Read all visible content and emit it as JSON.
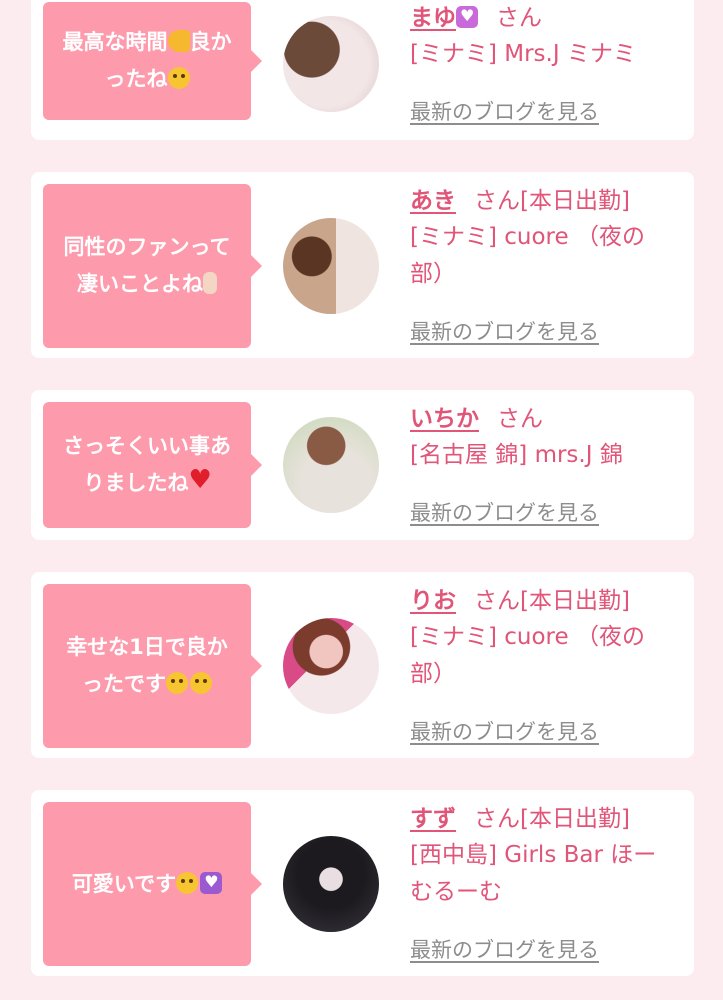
{
  "entries": [
    {
      "comment_lines": [
        "最高な時間",
        "ったね"
      ],
      "name": "まゆ",
      "san": "さん",
      "badge": "",
      "shop_lines": [
        "[ミナミ] Mrs.J ミナミ"
      ],
      "blog_link": "最新のブログを見る"
    },
    {
      "comment_lines": [
        "同性のファンって",
        "凄いことよね"
      ],
      "name": "あき",
      "san": "さん",
      "badge": "[本日出勤]",
      "shop_lines": [
        "[ミナミ] cuore （夜の",
        "部）"
      ],
      "blog_link": "最新のブログを見る"
    },
    {
      "comment_lines": [
        "さっそくいい事あ",
        "りましたね"
      ],
      "name": "いちか",
      "san": "さん",
      "badge": "",
      "shop_lines": [
        "[名古屋 錦] mrs.J 錦"
      ],
      "blog_link": "最新のブログを見る"
    },
    {
      "comment_lines": [
        "幸せな1日で良か",
        "ったです"
      ],
      "name": "りお",
      "san": "さん",
      "badge": "[本日出勤]",
      "shop_lines": [
        "[ミナミ] cuore （夜の",
        "部）"
      ],
      "blog_link": "最新のブログを見る"
    },
    {
      "comment_lines": [
        "可愛いです"
      ],
      "name": "すず",
      "san": "さん",
      "badge": "[本日出勤]",
      "shop_lines": [
        "[西中島] Girls Bar ほー",
        "むるーむ"
      ],
      "blog_link": "最新のブログを見る"
    }
  ],
  "comment_suffix_1a": "良か",
  "colors": {
    "bubble": "#fd9aac",
    "accent_text": "#e05578",
    "link_gray": "#8d8d8d",
    "background": "#fcecef"
  }
}
